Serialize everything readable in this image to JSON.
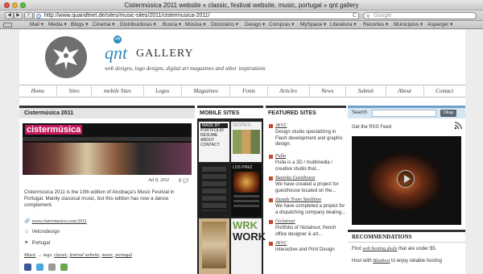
{
  "window": {
    "title": "Cistermúsica 2011 website » classic, festival website, music, portugal » qnt gallery"
  },
  "toolbar": {
    "back": "◀",
    "forward": "▶",
    "add": "+",
    "url": "http://www.quandtnet.de/sites/music-sites/2011/cistermusica-2011/",
    "refresh": "C",
    "search_placeholder": "Google"
  },
  "bookmarks": [
    "Mail ▾",
    "Media ▾",
    "Blogs ▾",
    "Cinema ▾",
    "Distribuidoras ▾",
    "Busca ▾",
    "Música ▾",
    "Dicionário ▾",
    "Design ▾",
    "Compras ▾",
    "MySpace ▾",
    "Literatura ▾",
    "Recortes ▾",
    "Municípios ▾",
    "Asperger ▾"
  ],
  "site": {
    "badge": "#6",
    "brand_qnt": "qnt",
    "brand_gallery": "GALLERY",
    "tagline": "web designs, logo designs, digital art magazines and other inspirations",
    "nav": [
      "Home",
      "Sites",
      "mobile Sites",
      "Logos",
      "Magazines",
      "Fonts",
      "Articles",
      "News",
      "Submit",
      "About",
      "Contact"
    ]
  },
  "post": {
    "heading": "Cistermúsica 2011",
    "image_logo": "cistermúsica",
    "date": "Jul 8, 2011",
    "comments": "0",
    "description": "Cistermúsica 2011 is the 10th edition of Alcobaça's Music Festival in Portugal. Mainly classical music, but this edition has now a dance complement.",
    "url": "www.cistermusica.com/2011",
    "designer": "Velcrodesign",
    "country": "Portugal",
    "tags_prefix": "→ tags:",
    "category": "Music",
    "tags": [
      "classic",
      "festival website",
      "music",
      "portugal"
    ]
  },
  "mobile_sites": {
    "heading": "MOBILE SITES",
    "thumb_labels": [
      "MADE BY",
      "PORTFOLIO",
      "RESUME",
      "ABOUT",
      "CONTACT",
      "WORKS",
      "LOS PREZ",
      "WRK",
      "WORK"
    ]
  },
  "featured": {
    "heading": "FEATURED SITES",
    "items": [
      {
        "title": "JKVC",
        "desc": "Design studio specializing in Flash development and graphic design."
      },
      {
        "title": "Pulla",
        "desc": "Pulla is a 3D / multimedia / creative studio that..."
      },
      {
        "title": "Buzzoka Guesthouse",
        "desc": "We have created a project for guesthouse located on the..."
      },
      {
        "title": "Zazada Trans Spedition",
        "desc": "We have completed a project for a dispatching company dealing..."
      },
      {
        "title": "l'éclaireur",
        "desc": "Portfolio of l'éclaireur, french office designer & art..."
      },
      {
        "title": "JKVC",
        "desc": "Interactive and Print Design"
      }
    ]
  },
  "sidebar": {
    "search_label": "Search",
    "search_button": "Okay",
    "rss_text": "Get the RSS Feed",
    "recommendations_heading": "RECOMMENDATIONS",
    "rec1_prefix": "Find",
    "rec1_link": "web hosting deals",
    "rec1_suffix": "that are under $5.",
    "rec2_prefix": "Host with",
    "rec2_link": "Bluehost",
    "rec2_suffix": "to enjoy reliable hosting"
  },
  "colors": {
    "accent": "#2f88b9",
    "search_bg": "#d5e6f3",
    "featured_icon": "#c24a2c"
  }
}
